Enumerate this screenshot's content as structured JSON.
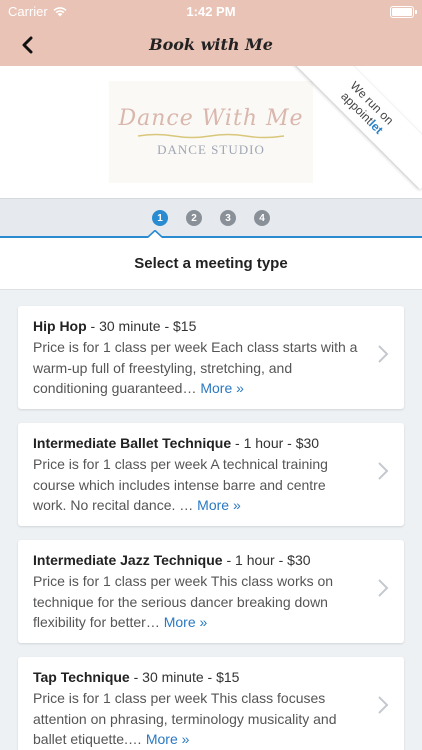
{
  "status_bar": {
    "carrier": "Carrier",
    "time": "1:42 PM"
  },
  "nav": {
    "title": "Book with Me"
  },
  "logo": {
    "script_text": "Dance With Me",
    "studio_text": "DANCE STUDIO"
  },
  "ribbon": {
    "line1": "We run on",
    "line2_prefix": "appoint",
    "line2_accent": "let"
  },
  "stepper": {
    "steps": [
      "1",
      "2",
      "3",
      "4"
    ],
    "active_step": 1
  },
  "section_title": "Select a meeting type",
  "meeting_types": [
    {
      "name": "Hip Hop",
      "meta": " - 30 minute  - $15",
      "description": "Price is for 1 class per week Each class starts with a warm-up full of freestyling, stretching, and conditioning guaranteed… ",
      "more": "More »"
    },
    {
      "name": "Intermediate Ballet Technique",
      "meta": " - 1 hour  - $30",
      "description": "Price is for 1 class per week A technical training course which includes intense barre and centre work. No recital dance. … ",
      "more": "More »"
    },
    {
      "name": "Intermediate Jazz Technique",
      "meta": " - 1 hour  - $30",
      "description": "Price is for 1 class per week This class works on technique for the serious dancer breaking down flexibility for better… ",
      "more": "More »"
    },
    {
      "name": "Tap Technique",
      "meta": " - 30 minute  - $15",
      "description": "Price is for 1 class per week This class focuses attention on phrasing, terminology musicality and ballet etiquette.… ",
      "more": "More »"
    }
  ],
  "colors": {
    "nav_bg": "#e9c3b6",
    "accent": "#2a8bd0",
    "link": "#2a79c2"
  }
}
